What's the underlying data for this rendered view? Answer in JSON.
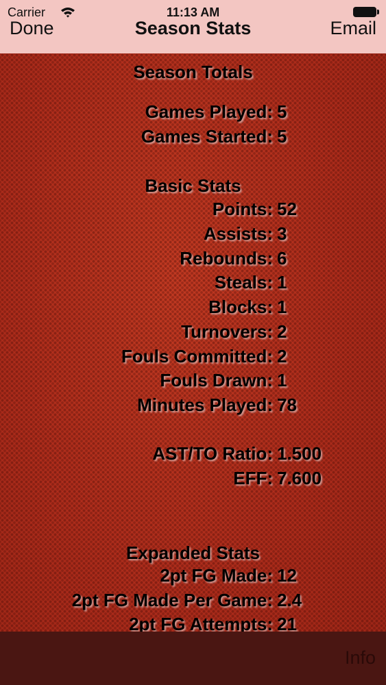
{
  "status_bar": {
    "carrier": "Carrier",
    "time": "11:13 AM"
  },
  "nav": {
    "left_button": "Done",
    "title": "Season Stats",
    "right_button": "Email"
  },
  "sections": {
    "season_totals": {
      "title": "Season Totals",
      "rows": [
        {
          "label": "Games Played:",
          "value": "5"
        },
        {
          "label": "Games Started:",
          "value": "5"
        }
      ]
    },
    "basic_stats": {
      "title": "Basic Stats",
      "rows": [
        {
          "label": "Points:",
          "value": "52"
        },
        {
          "label": "Assists:",
          "value": "3"
        },
        {
          "label": "Rebounds:",
          "value": "6"
        },
        {
          "label": "Steals:",
          "value": "1"
        },
        {
          "label": "Blocks:",
          "value": "1"
        },
        {
          "label": "Turnovers:",
          "value": "2"
        },
        {
          "label": "Fouls Committed:",
          "value": "2"
        },
        {
          "label": "Fouls Drawn:",
          "value": "1"
        },
        {
          "label": "Minutes Played:",
          "value": "78"
        }
      ]
    },
    "ratios": {
      "rows": [
        {
          "label": "AST/TO Ratio:",
          "value": "1.500"
        },
        {
          "label": "EFF:",
          "value": "7.600"
        }
      ]
    },
    "expanded_stats": {
      "title": "Expanded Stats",
      "rows": [
        {
          "label": "2pt FG Made:",
          "value": "12"
        },
        {
          "label": "2pt FG Made Per Game:",
          "value": "2.4"
        },
        {
          "label": "2pt FG Attempts:",
          "value": "21"
        }
      ]
    }
  },
  "toolbar": {
    "info_label": "Info"
  },
  "colors": {
    "nav_background": "#f3c6c2",
    "leather_background": "#b3301f",
    "toolbar_background": "#4a1612"
  }
}
